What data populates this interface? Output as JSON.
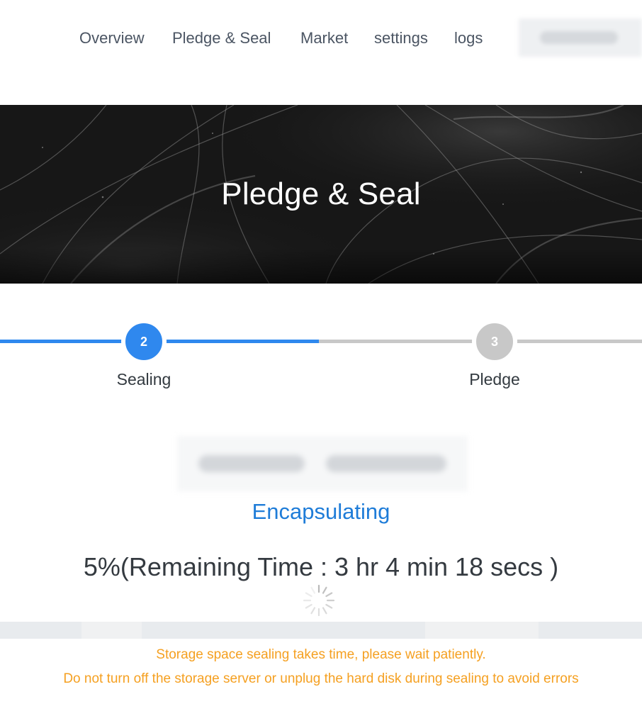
{
  "nav": {
    "items": [
      {
        "label": "Overview"
      },
      {
        "label": "Pledge & Seal"
      },
      {
        "label": "Market"
      },
      {
        "label": "settings"
      },
      {
        "label": "logs"
      }
    ]
  },
  "hero": {
    "title": "Pledge & Seal"
  },
  "stepper": {
    "active_color": "#2f88ee",
    "inactive_color": "#c8c8c8",
    "steps": [
      {
        "number": "2",
        "label": "Sealing",
        "state": "active"
      },
      {
        "number": "3",
        "label": "Pledge",
        "state": "pending"
      }
    ]
  },
  "main": {
    "status": "Encapsulating",
    "progress": "5%(Remaining Time : 3 hr 4 min 18 secs )",
    "progress_value_percent": 5
  },
  "notice": {
    "line1": "Storage space sealing takes time, please wait patiently.",
    "line2": "Do not turn off the storage server or unplug the hard disk during sealing to avoid errors",
    "color": "#f5a021"
  }
}
